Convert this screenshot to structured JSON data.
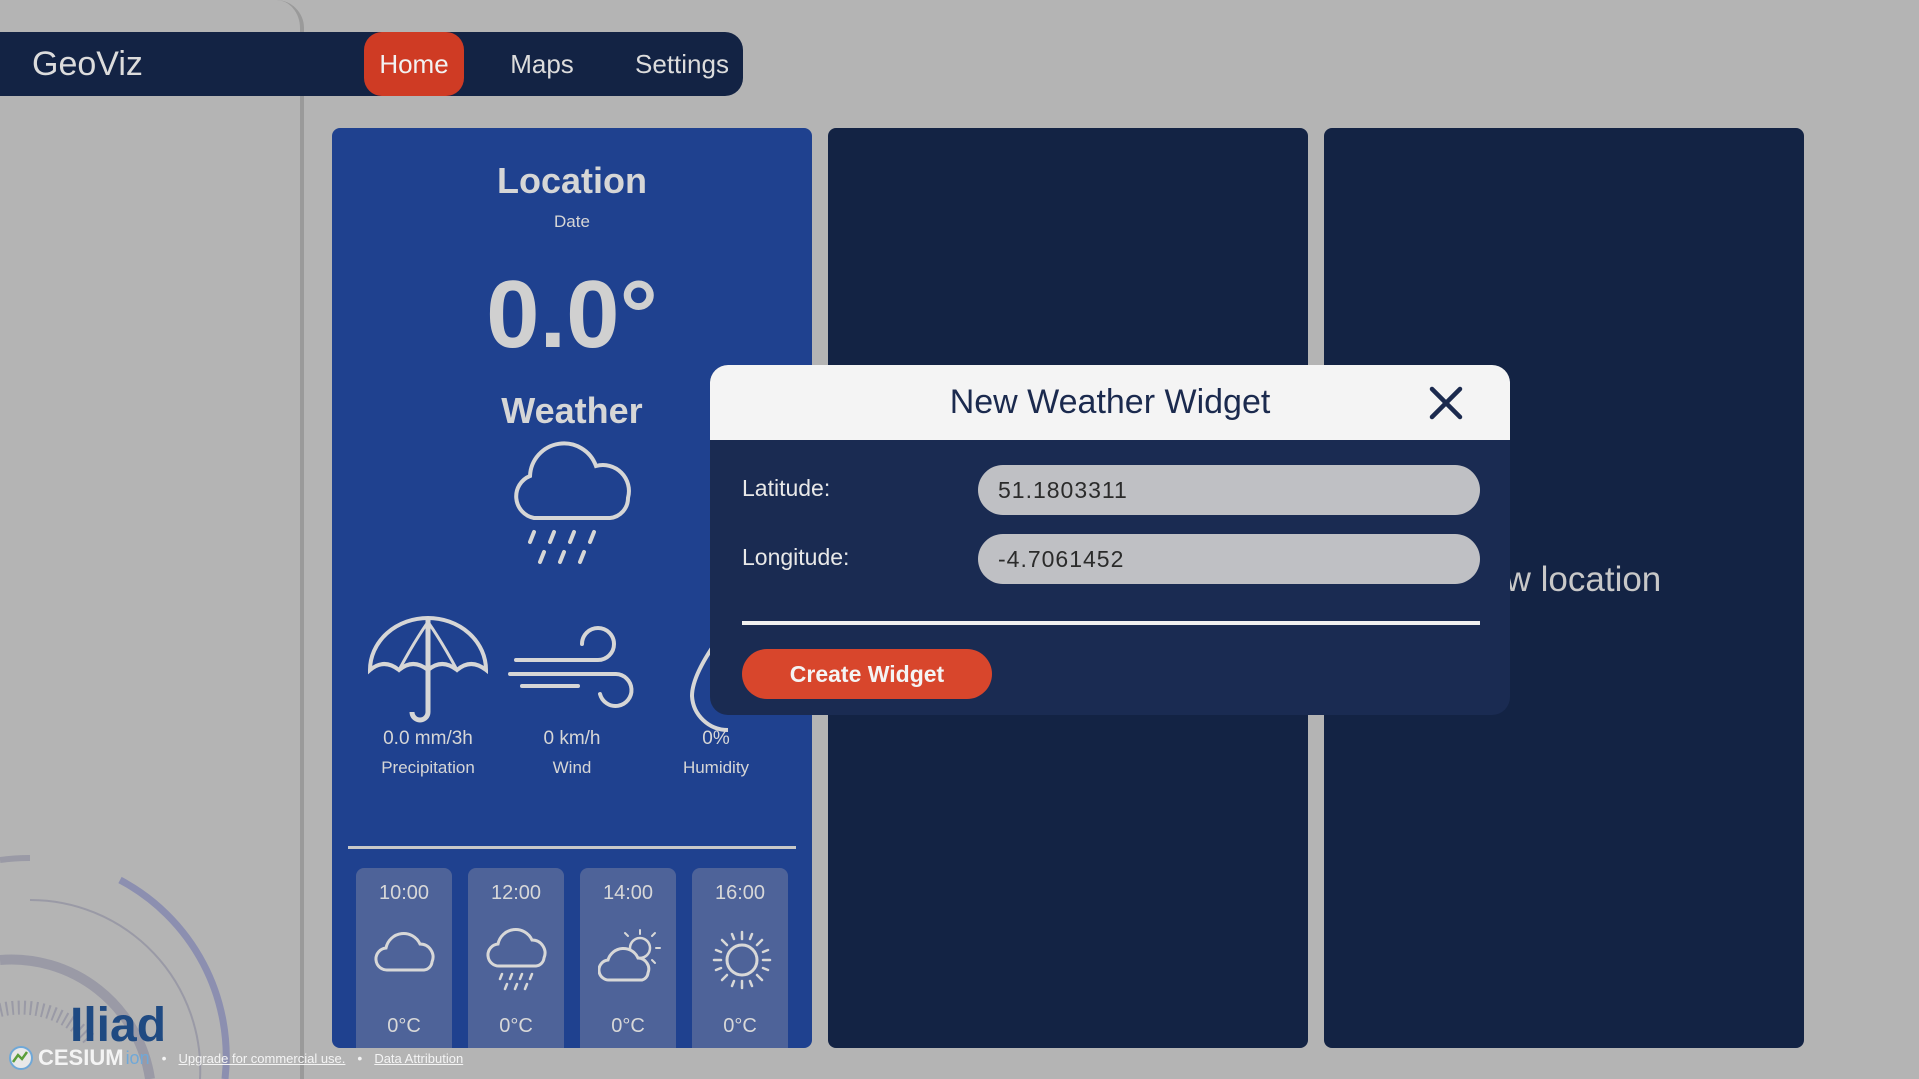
{
  "nav": {
    "brand": "GeoViz",
    "items": [
      {
        "label": "Home",
        "active": true
      },
      {
        "label": "Maps",
        "active": false
      },
      {
        "label": "Settings",
        "active": false
      }
    ]
  },
  "weather_card": {
    "location": "Location",
    "date": "Date",
    "temperature": "0.0°",
    "condition": "Weather",
    "condition_icon": "cloud-rain-icon",
    "metrics": [
      {
        "value": "0.0 mm/3h",
        "label": "Precipitation",
        "icon": "umbrella-icon"
      },
      {
        "value": "0 km/h",
        "label": "Wind",
        "icon": "wind-icon"
      },
      {
        "value": "0%",
        "label": "Humidity",
        "icon": "droplet-icon"
      }
    ],
    "hourly": [
      {
        "time": "10:00",
        "temp": "0°C",
        "icon": "cloud-icon"
      },
      {
        "time": "12:00",
        "temp": "0°C",
        "icon": "cloud-rain-icon"
      },
      {
        "time": "14:00",
        "temp": "0°C",
        "icon": "partly-sunny-icon"
      },
      {
        "time": "16:00",
        "temp": "0°C",
        "icon": "sun-icon"
      }
    ]
  },
  "add_panel_text": "new location",
  "modal": {
    "title": "New Weather Widget",
    "latitude_label": "Latitude:",
    "latitude_value": "51.1803311",
    "longitude_label": "Longitude:",
    "longitude_value": "-4.7061452",
    "create_label": "Create Widget"
  },
  "footer": {
    "iliad_logo": "Iliad",
    "cesium_logo": "CESIUM",
    "cesium_ion": "ion",
    "separator": "•",
    "upgrade_link": "Upgrade for commercial use.",
    "attribution_link": "Data Attribution"
  },
  "colors": {
    "background": "#b4b4b4",
    "navbar": "#132344",
    "nav_active": "#cf3b24",
    "weather_card": "#1f418f",
    "dark_panel": "#132344",
    "modal_body": "#1a2b52",
    "create_button": "#d8462c"
  }
}
